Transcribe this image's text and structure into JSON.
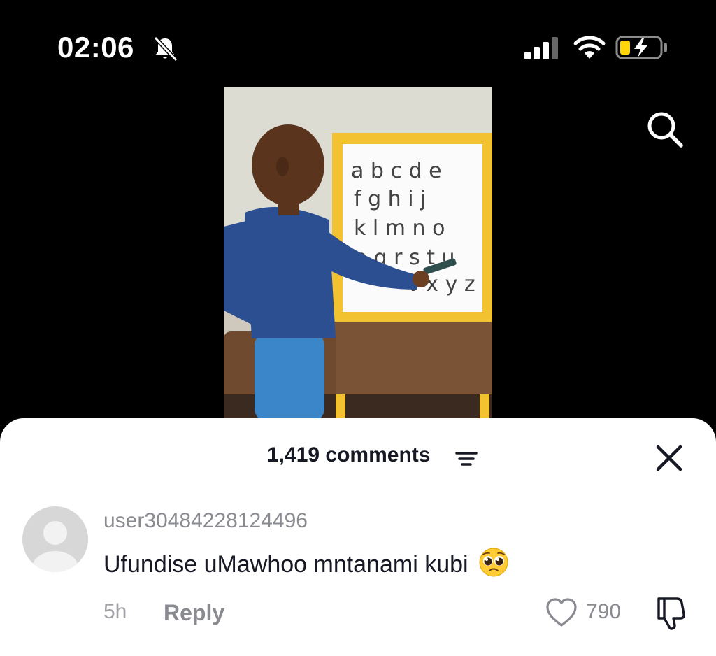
{
  "status_bar": {
    "time": "02:06",
    "icons": [
      "bell-slash-icon",
      "signal-icon",
      "wifi-icon",
      "battery-charging-icon"
    ]
  },
  "header": {
    "search_icon": "search-icon"
  },
  "video": {
    "thumbnail": "child-pointing-at-alphabet-whiteboard"
  },
  "comments_sheet": {
    "title": "1,419 comments",
    "filter_icon": "filter-icon",
    "close_icon": "close-icon",
    "comments": [
      {
        "username": "user30484228124496",
        "text": "Ufundise uMawhoo mntanami kubi",
        "emoji": "pleading-face-emoji",
        "time": "5h",
        "reply_label": "Reply",
        "likes": "790"
      }
    ]
  },
  "colors": {
    "background": "#000000",
    "sheet": "#ffffff",
    "text_primary": "#161823",
    "text_secondary": "#8a8b91",
    "battery_fill": "#ffd60a"
  }
}
